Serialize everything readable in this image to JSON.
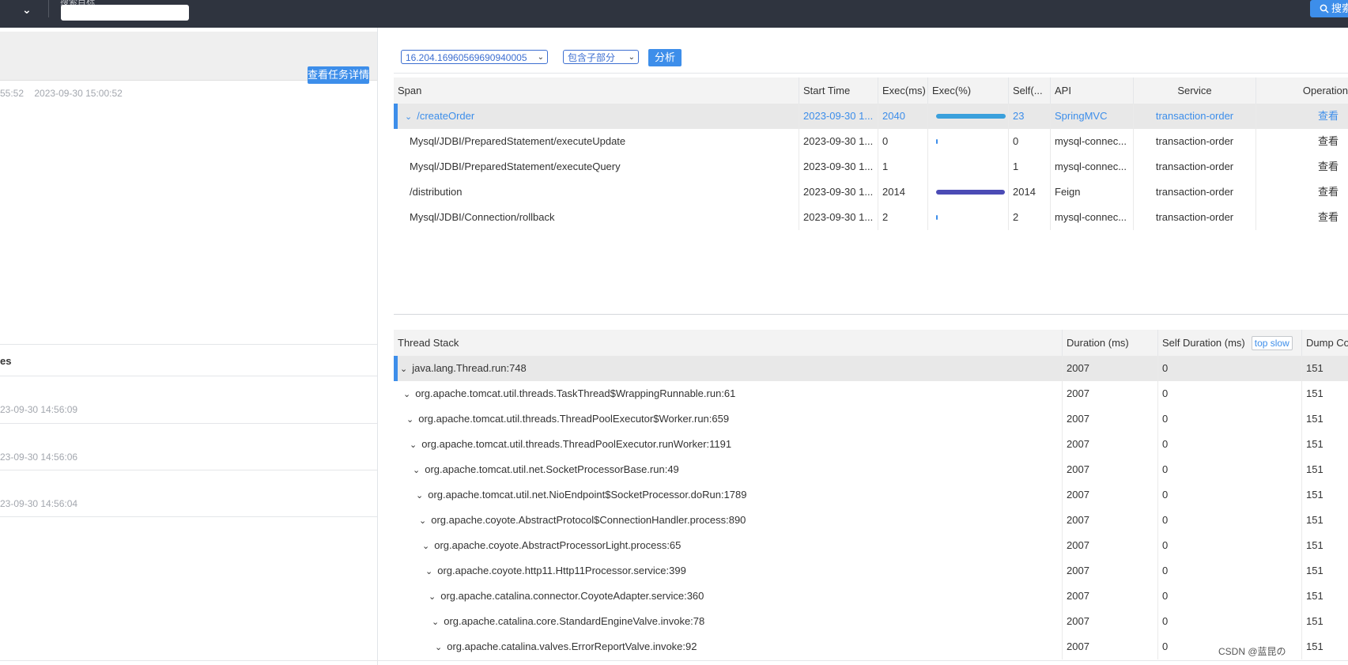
{
  "topbar": {
    "faded_label": "搜索目标",
    "search_button": "搜索"
  },
  "task": {
    "detail_button": "查看任务详情",
    "start_time": "55:52",
    "end_time": "2023-09-30 15:00:52"
  },
  "left_list": {
    "section_title": "es",
    "times": [
      "23-09-30 14:56:09",
      "23-09-30 14:56:06",
      "23-09-30 14:56:04"
    ]
  },
  "controls": {
    "instance_select": "16.204.16960569690940005",
    "scope_select": "包含子部分",
    "analyze_button": "分析"
  },
  "span_table": {
    "headers": [
      "Span",
      "Start Time",
      "Exec(ms)",
      "Exec(%)",
      "Self(...",
      "API",
      "Service",
      "Operation"
    ],
    "rows": [
      {
        "span": "/createOrder",
        "start": "2023-09-30 1...",
        "exec": "2040",
        "pct": 1.0,
        "self": "23",
        "api": "SpringMVC",
        "service": "transaction-order",
        "op": "查看",
        "color": "#3aa0dc"
      },
      {
        "span": "Mysql/JDBI/PreparedStatement/executeUpdate",
        "start": "2023-09-30 1...",
        "exec": "0",
        "pct": 0.0,
        "self": "0",
        "api": "mysql-connec...",
        "service": "transaction-order",
        "op": "查看",
        "color": "#3d8eea"
      },
      {
        "span": "Mysql/JDBI/PreparedStatement/executeQuery",
        "start": "2023-09-30 1...",
        "exec": "1",
        "pct": 0.0,
        "self": "1",
        "api": "mysql-connec...",
        "service": "transaction-order",
        "op": "查看",
        "color": "#3d8eea"
      },
      {
        "span": "/distribution",
        "start": "2023-09-30 1...",
        "exec": "2014",
        "pct": 0.99,
        "self": "2014",
        "api": "Feign",
        "service": "transaction-order",
        "op": "查看",
        "color": "#4b4bb5"
      },
      {
        "span": "Mysql/JDBI/Connection/rollback",
        "start": "2023-09-30 1...",
        "exec": "2",
        "pct": 0.0,
        "self": "2",
        "api": "mysql-connec...",
        "service": "transaction-order",
        "op": "查看",
        "color": "#3d8eea"
      }
    ]
  },
  "stack_table": {
    "headers": {
      "stack": "Thread Stack",
      "duration": "Duration (ms)",
      "self_duration": "Self Duration (ms)",
      "top_slow": "top slow",
      "dump": "Dump Co"
    },
    "rows": [
      {
        "name": "java.lang.Thread.run:748",
        "duration": "2007",
        "self": "0",
        "dump": "151"
      },
      {
        "name": "org.apache.tomcat.util.threads.TaskThread$WrappingRunnable.run:61",
        "duration": "2007",
        "self": "0",
        "dump": "151"
      },
      {
        "name": "org.apache.tomcat.util.threads.ThreadPoolExecutor$Worker.run:659",
        "duration": "2007",
        "self": "0",
        "dump": "151"
      },
      {
        "name": "org.apache.tomcat.util.threads.ThreadPoolExecutor.runWorker:1191",
        "duration": "2007",
        "self": "0",
        "dump": "151"
      },
      {
        "name": "org.apache.tomcat.util.net.SocketProcessorBase.run:49",
        "duration": "2007",
        "self": "0",
        "dump": "151"
      },
      {
        "name": "org.apache.tomcat.util.net.NioEndpoint$SocketProcessor.doRun:1789",
        "duration": "2007",
        "self": "0",
        "dump": "151"
      },
      {
        "name": "org.apache.coyote.AbstractProtocol$ConnectionHandler.process:890",
        "duration": "2007",
        "self": "0",
        "dump": "151"
      },
      {
        "name": "org.apache.coyote.AbstractProcessorLight.process:65",
        "duration": "2007",
        "self": "0",
        "dump": "151"
      },
      {
        "name": "org.apache.coyote.http11.Http11Processor.service:399",
        "duration": "2007",
        "self": "0",
        "dump": "151"
      },
      {
        "name": "org.apache.catalina.connector.CoyoteAdapter.service:360",
        "duration": "2007",
        "self": "0",
        "dump": "151"
      },
      {
        "name": "org.apache.catalina.core.StandardEngineValve.invoke:78",
        "duration": "2007",
        "self": "0",
        "dump": "151"
      },
      {
        "name": "org.apache.catalina.valves.ErrorReportValve.invoke:92",
        "duration": "2007",
        "self": "0",
        "dump": "151"
      }
    ]
  },
  "watermark": "CSDN @蓝昆の"
}
